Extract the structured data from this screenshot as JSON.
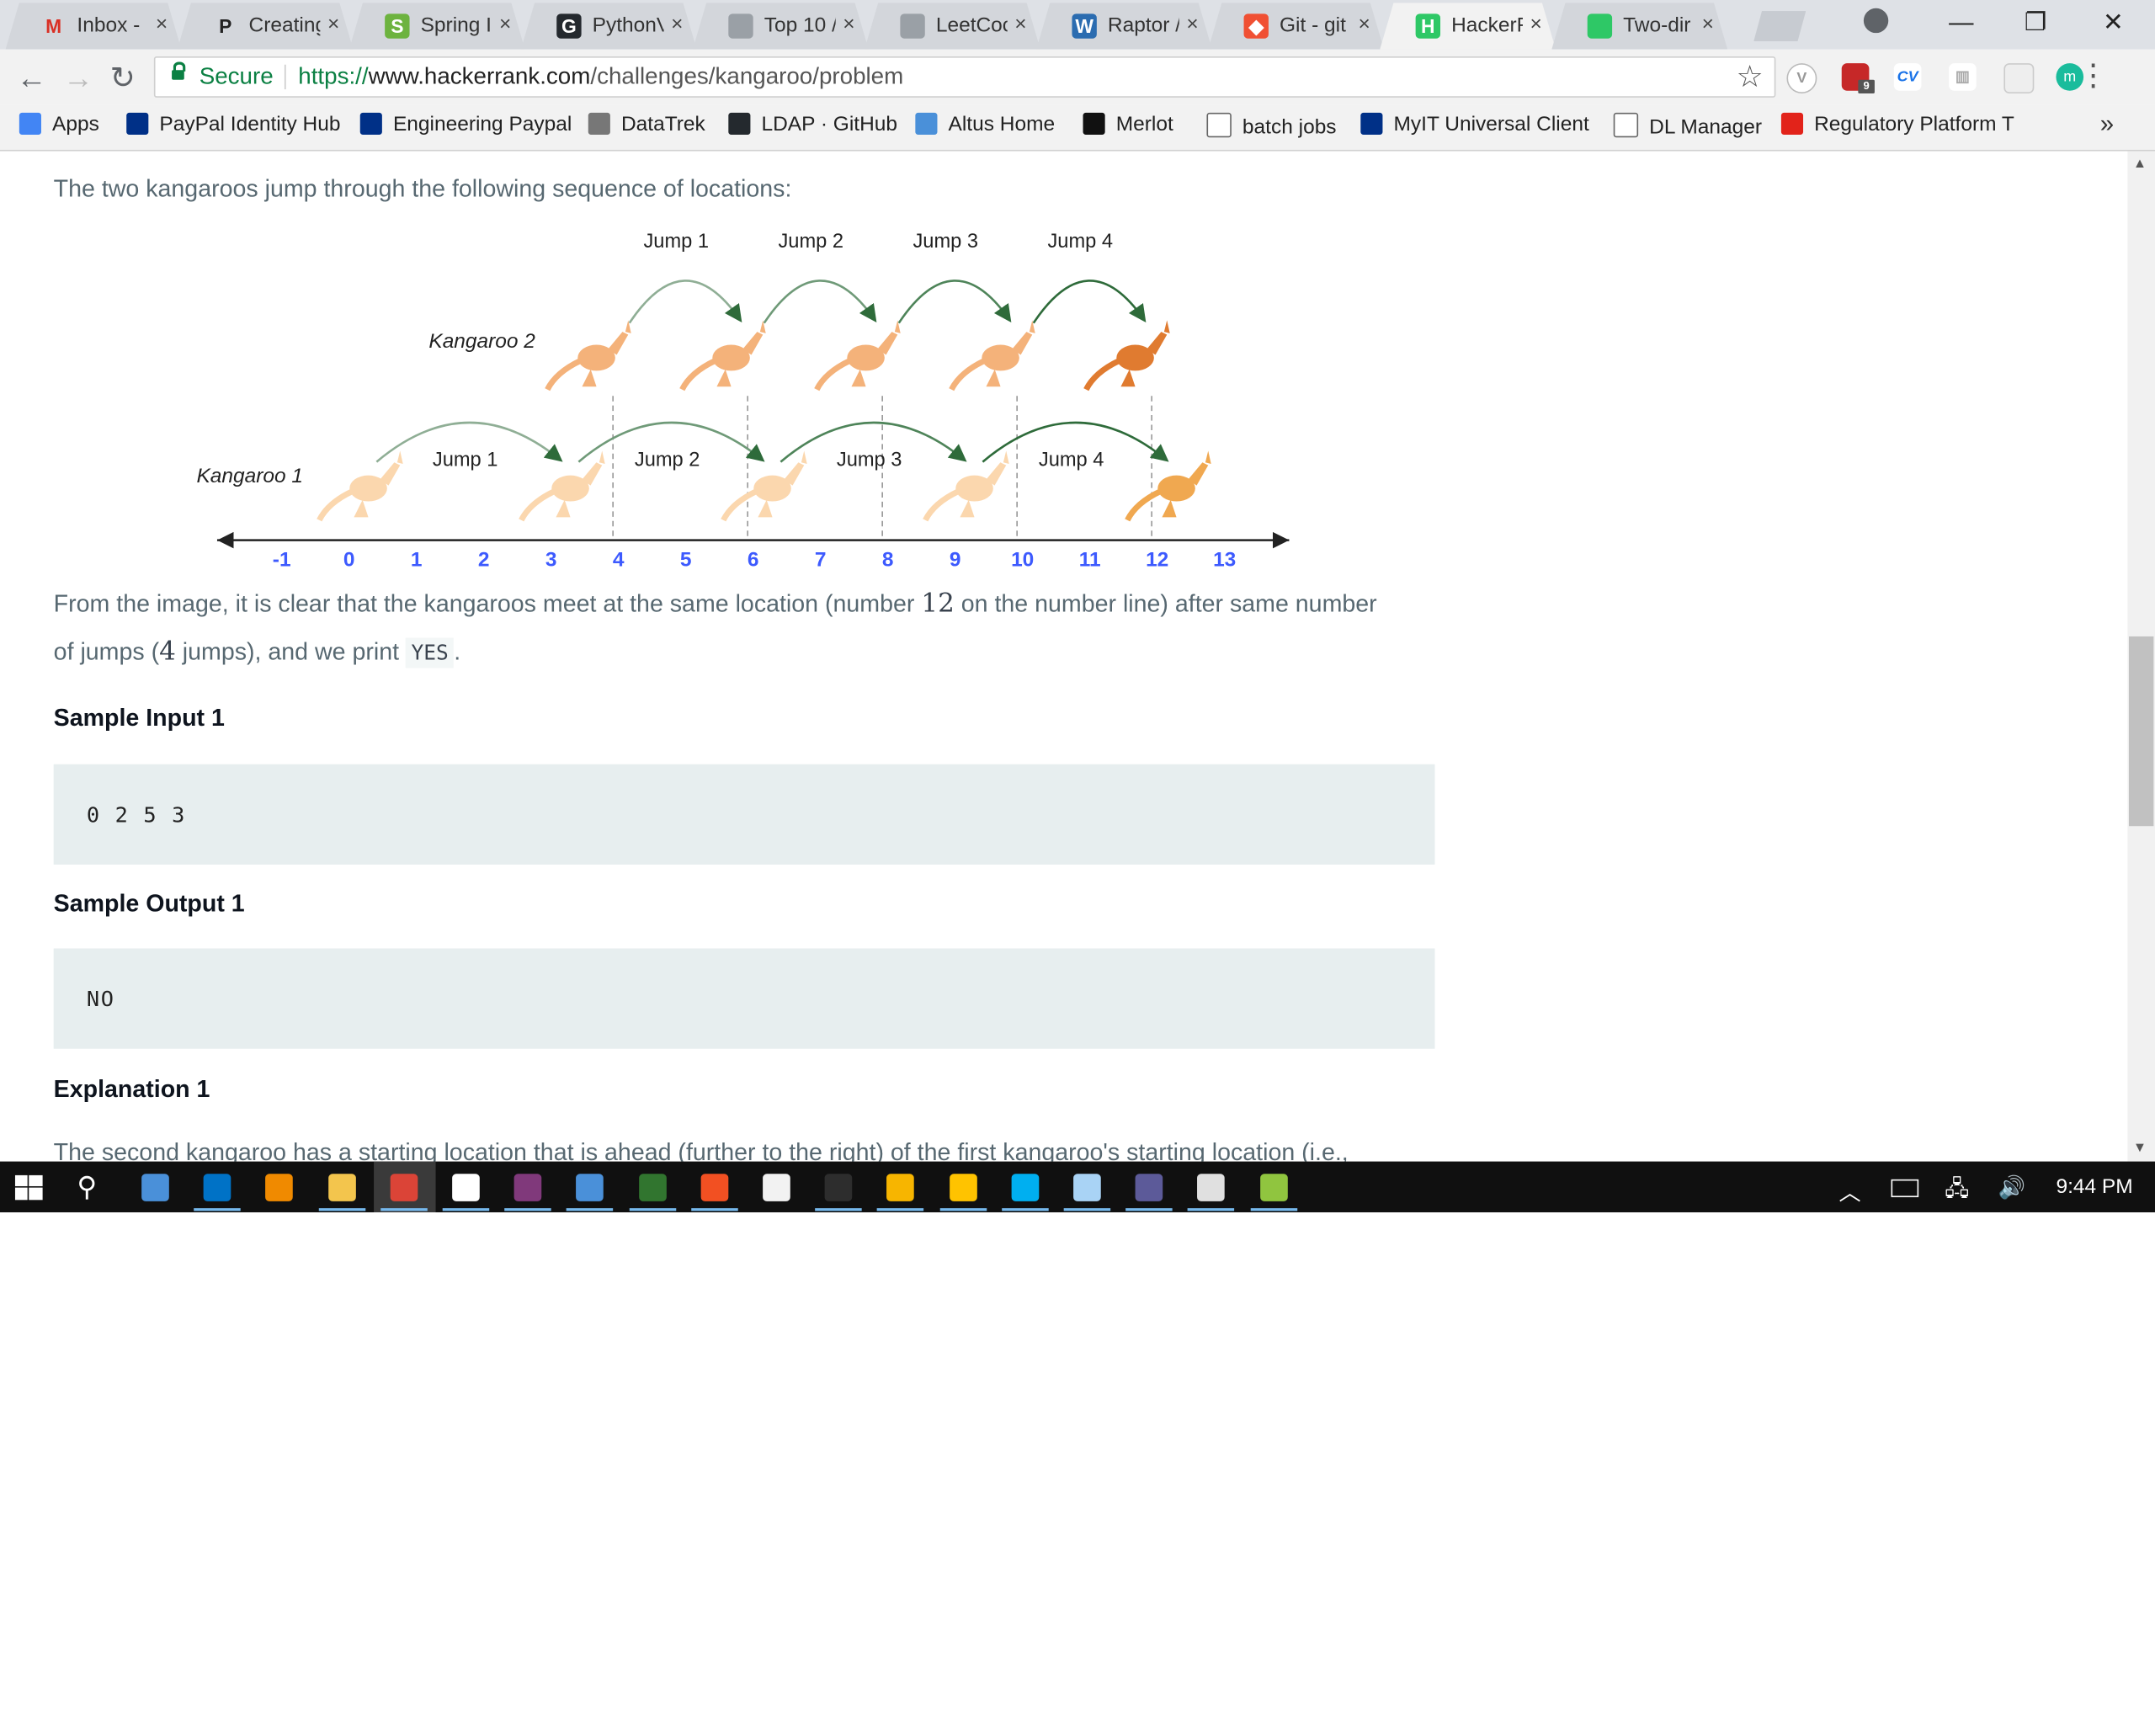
{
  "browser": {
    "tabs": [
      {
        "title": "Inbox -",
        "icon": "gmail-icon",
        "color": "#d93025",
        "glyph": "M"
      },
      {
        "title": "Creating",
        "icon": "p-icon",
        "color": "#222222",
        "glyph": "P"
      },
      {
        "title": "Spring I",
        "icon": "spring-icon",
        "color": "#6db33f",
        "glyph": "S"
      },
      {
        "title": "PythonV",
        "icon": "github-icon",
        "color": "#24292e",
        "glyph": "G"
      },
      {
        "title": "Top 10 /",
        "icon": "image-icon",
        "color": "#9aa0a6",
        "glyph": ""
      },
      {
        "title": "LeetCoc",
        "icon": "image-icon",
        "color": "#9aa0a6",
        "glyph": ""
      },
      {
        "title": "Raptor /",
        "icon": "raptor-icon",
        "color": "#2b6cb0",
        "glyph": "W"
      },
      {
        "title": "Git - git",
        "icon": "git-icon",
        "color": "#f05033",
        "glyph": "◆"
      },
      {
        "title": "HackerF",
        "icon": "hackerrank-icon",
        "color": "#2ec866",
        "glyph": "H"
      },
      {
        "title": "Two-dir",
        "icon": "cloud-icon",
        "color": "#2ec866",
        "glyph": ""
      }
    ],
    "active_tab": 8,
    "close_glyph": "×",
    "url_scheme": "https://",
    "url_host": "www.hackerrank.com",
    "url_path": "/challenges/kangaroo/problem",
    "secure_label": "Secure",
    "bookmarks": [
      {
        "label": "Apps",
        "icon": "apps-icon",
        "color": "#4285f4"
      },
      {
        "label": "PayPal Identity Hub",
        "icon": "paypal-icon",
        "color": "#003087"
      },
      {
        "label": "Engineering Paypal",
        "icon": "paypal-icon",
        "color": "#003087"
      },
      {
        "label": "DataTrek",
        "icon": "datatrek-icon",
        "color": "#777777"
      },
      {
        "label": "LDAP · GitHub",
        "icon": "github-icon",
        "color": "#24292e"
      },
      {
        "label": "Altus Home",
        "icon": "altus-icon",
        "color": "#4a90d9"
      },
      {
        "label": "Merlot",
        "icon": "merlot-icon",
        "color": "#111111"
      },
      {
        "label": "batch jobs",
        "icon": "page-icon",
        "color": "#ffffff"
      },
      {
        "label": "MyIT Universal Client",
        "icon": "paypal-icon",
        "color": "#003087"
      },
      {
        "label": "DL Manager",
        "icon": "page-icon",
        "color": "#ffffff"
      },
      {
        "label": "Regulatory Platform T",
        "icon": "regulatory-icon",
        "color": "#e2231a"
      }
    ],
    "bookmarks_more": "»",
    "ext_badge": "9"
  },
  "page": {
    "intro": "The two kangaroos jump through the following sequence of locations:",
    "diagram": {
      "kangaroo1_label": "Kangaroo 1",
      "kangaroo2_label": "Kangaroo 2",
      "k1_jump_labels": [
        "Jump 1",
        "Jump 2",
        "Jump 3",
        "Jump 4"
      ],
      "k2_jump_labels": [
        "Jump 1",
        "Jump 2",
        "Jump 3",
        "Jump 4"
      ],
      "ticks": [
        "-1",
        "0",
        "1",
        "2",
        "3",
        "4",
        "5",
        "6",
        "7",
        "8",
        "9",
        "10",
        "11",
        "12",
        "13"
      ],
      "k1_positions": [
        0,
        3,
        6,
        9,
        12
      ],
      "k2_positions": [
        4,
        6,
        8,
        10,
        12
      ]
    },
    "explanation_pre": "From the image, it is clear that the kangaroos meet at the same location (number ",
    "meet_number": "12",
    "explanation_mid": " on the number line) after same number",
    "explanation_line2_pre": "of jumps (",
    "jump_count": "4",
    "explanation_line2_mid": " jumps), and we print ",
    "yes_code": "YES",
    "explanation_line2_end": ".",
    "sample_input_heading": "Sample Input 1",
    "sample_input": "0 2 5 3",
    "sample_output_heading": "Sample Output 1",
    "sample_output": "NO",
    "explanation_heading": "Explanation 1",
    "explanation1_text": "The second kangaroo has a starting location that is ahead (further to the right) of the first kangaroo's starting location (i.e.,"
  },
  "taskbar": {
    "clock": "9:44 PM",
    "apps": [
      {
        "name": "remote-desktop-icon",
        "color": "#4a90d9"
      },
      {
        "name": "outlook-icon",
        "color": "#0072c6"
      },
      {
        "name": "vlc-icon",
        "color": "#f08a00"
      },
      {
        "name": "file-explorer-icon",
        "color": "#f3c54d"
      },
      {
        "name": "chrome-icon",
        "color": "#db4437"
      },
      {
        "name": "slack-icon",
        "color": "#ffffff"
      },
      {
        "name": "onenote-icon",
        "color": "#80397b"
      },
      {
        "name": "network-icon",
        "color": "#4a90d9"
      },
      {
        "name": "project-icon",
        "color": "#31752f"
      },
      {
        "name": "pen-icon",
        "color": "#f25022"
      },
      {
        "name": "itunes-icon",
        "color": "#f2f2f2"
      },
      {
        "name": "terminal-icon",
        "color": "#2d2d2d"
      },
      {
        "name": "splash-icon",
        "color": "#f7b500"
      },
      {
        "name": "norton-icon",
        "color": "#ffc300"
      },
      {
        "name": "skype-icon",
        "color": "#00aff0"
      },
      {
        "name": "notepad-icon",
        "color": "#a9d3f5"
      },
      {
        "name": "eclipse-icon",
        "color": "#5c5a99"
      },
      {
        "name": "paint-icon",
        "color": "#e0e0e0"
      },
      {
        "name": "notepadpp-icon",
        "color": "#90c53f"
      }
    ]
  }
}
